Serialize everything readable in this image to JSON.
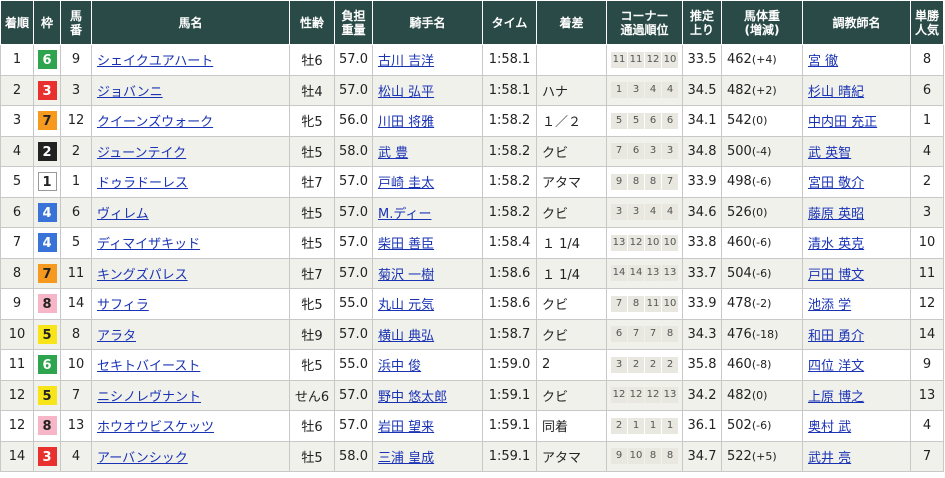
{
  "headers": {
    "rank": "着順",
    "waku": "枠",
    "umaban_1": "馬",
    "umaban_2": "番",
    "horse": "馬名",
    "sexage": "性齢",
    "weight_1": "負担",
    "weight_2": "重量",
    "jockey": "騎手名",
    "time": "タイム",
    "margin": "着差",
    "corner_1": "コーナー",
    "corner_2": "通過順位",
    "last3f_1": "推定",
    "last3f_2": "上り",
    "bodyweight_1": "馬体重",
    "bodyweight_2": "(増減)",
    "trainer": "調教師名",
    "pop_1": "単勝",
    "pop_2": "人気"
  },
  "waku_colors": {
    "1": {
      "bg": "#ffffff",
      "fg": "#222222",
      "border": "#999999"
    },
    "2": {
      "bg": "#222222",
      "fg": "#ffffff",
      "border": "#222222"
    },
    "3": {
      "bg": "#e8312f",
      "fg": "#ffffff",
      "border": "#e8312f"
    },
    "4": {
      "bg": "#3a73d8",
      "fg": "#ffffff",
      "border": "#3a73d8"
    },
    "5": {
      "bg": "#f7e51a",
      "fg": "#222222",
      "border": "#f7e51a"
    },
    "6": {
      "bg": "#2ea44f",
      "fg": "#ffffff",
      "border": "#2ea44f"
    },
    "7": {
      "bg": "#f59a1f",
      "fg": "#222222",
      "border": "#f59a1f"
    },
    "8": {
      "bg": "#f7b6c8",
      "fg": "#222222",
      "border": "#f7b6c8"
    }
  },
  "rows": [
    {
      "rank": "1",
      "waku": "6",
      "umaban": "9",
      "horse": "シェイクユアハート",
      "sexage": "牡6",
      "weight": "57.0",
      "jockey": "古川 吉洋",
      "time": "1:58.1",
      "margin": "",
      "corners": [
        "11",
        "11",
        "12",
        "10"
      ],
      "last3f": "33.5",
      "bodyweight": "462",
      "diff": "(+4)",
      "trainer": "宮 徹",
      "pop": "8"
    },
    {
      "rank": "2",
      "waku": "3",
      "umaban": "3",
      "horse": "ジョバンニ",
      "sexage": "牡4",
      "weight": "57.0",
      "jockey": "松山 弘平",
      "time": "1:58.1",
      "margin": "ハナ",
      "corners": [
        "1",
        "3",
        "4",
        "4"
      ],
      "last3f": "34.5",
      "bodyweight": "482",
      "diff": "(+2)",
      "trainer": "杉山 晴紀",
      "pop": "6"
    },
    {
      "rank": "3",
      "waku": "7",
      "umaban": "12",
      "horse": "クイーンズウォーク",
      "sexage": "牝5",
      "weight": "56.0",
      "jockey": "川田 将雅",
      "time": "1:58.2",
      "margin": "１／２",
      "corners": [
        "5",
        "5",
        "6",
        "6"
      ],
      "last3f": "34.1",
      "bodyweight": "542",
      "diff": "(0)",
      "trainer": "中内田 充正",
      "pop": "1"
    },
    {
      "rank": "4",
      "waku": "2",
      "umaban": "2",
      "horse": "ジューンテイク",
      "sexage": "牡5",
      "weight": "58.0",
      "jockey": "武 豊",
      "time": "1:58.2",
      "margin": "クビ",
      "corners": [
        "7",
        "6",
        "3",
        "3"
      ],
      "last3f": "34.8",
      "bodyweight": "500",
      "diff": "(-4)",
      "trainer": "武 英智",
      "pop": "4"
    },
    {
      "rank": "5",
      "waku": "1",
      "umaban": "1",
      "horse": "ドゥラドーレス",
      "sexage": "牡7",
      "weight": "57.0",
      "jockey": "戸崎 圭太",
      "time": "1:58.2",
      "margin": "アタマ",
      "corners": [
        "9",
        "8",
        "8",
        "7"
      ],
      "last3f": "33.9",
      "bodyweight": "498",
      "diff": "(-6)",
      "trainer": "宮田 敬介",
      "pop": "2"
    },
    {
      "rank": "6",
      "waku": "4",
      "umaban": "6",
      "horse": "ヴィレム",
      "sexage": "牡5",
      "weight": "57.0",
      "jockey": "M.ディー",
      "time": "1:58.2",
      "margin": "クビ",
      "corners": [
        "3",
        "3",
        "4",
        "4"
      ],
      "last3f": "34.6",
      "bodyweight": "526",
      "diff": "(0)",
      "trainer": "藤原 英昭",
      "pop": "3"
    },
    {
      "rank": "7",
      "waku": "4",
      "umaban": "5",
      "horse": "ディマイザキッド",
      "sexage": "牡5",
      "weight": "57.0",
      "jockey": "柴田 善臣",
      "time": "1:58.4",
      "margin": "１ 1/4",
      "corners": [
        "13",
        "12",
        "10",
        "10"
      ],
      "last3f": "33.8",
      "bodyweight": "460",
      "diff": "(-6)",
      "trainer": "清水 英克",
      "pop": "10"
    },
    {
      "rank": "8",
      "waku": "7",
      "umaban": "11",
      "horse": "キングズパレス",
      "sexage": "牡7",
      "weight": "57.0",
      "jockey": "菊沢 一樹",
      "time": "1:58.6",
      "margin": "１ 1/4",
      "corners": [
        "14",
        "14",
        "13",
        "13"
      ],
      "last3f": "33.7",
      "bodyweight": "504",
      "diff": "(-6)",
      "trainer": "戸田 博文",
      "pop": "11"
    },
    {
      "rank": "9",
      "waku": "8",
      "umaban": "14",
      "horse": "サフィラ",
      "sexage": "牝5",
      "weight": "55.0",
      "jockey": "丸山 元気",
      "time": "1:58.6",
      "margin": "クビ",
      "corners": [
        "7",
        "8",
        "11",
        "10"
      ],
      "last3f": "33.9",
      "bodyweight": "478",
      "diff": "(-2)",
      "trainer": "池添 学",
      "pop": "12"
    },
    {
      "rank": "10",
      "waku": "5",
      "umaban": "8",
      "horse": "アラタ",
      "sexage": "牡9",
      "weight": "57.0",
      "jockey": "横山 典弘",
      "time": "1:58.7",
      "margin": "クビ",
      "corners": [
        "6",
        "7",
        "7",
        "8"
      ],
      "last3f": "34.3",
      "bodyweight": "476",
      "diff": "(-18)",
      "trainer": "和田 勇介",
      "pop": "14"
    },
    {
      "rank": "11",
      "waku": "6",
      "umaban": "10",
      "horse": "セキトバイースト",
      "sexage": "牝5",
      "weight": "55.0",
      "jockey": "浜中 俊",
      "time": "1:59.0",
      "margin": "2",
      "corners": [
        "3",
        "2",
        "2",
        "2"
      ],
      "last3f": "35.8",
      "bodyweight": "460",
      "diff": "(-8)",
      "trainer": "四位 洋文",
      "pop": "9"
    },
    {
      "rank": "12",
      "waku": "5",
      "umaban": "7",
      "horse": "ニシノレヴナント",
      "sexage": "せん6",
      "weight": "57.0",
      "jockey": "野中 悠太郎",
      "time": "1:59.1",
      "margin": "クビ",
      "corners": [
        "12",
        "12",
        "12",
        "13"
      ],
      "last3f": "34.2",
      "bodyweight": "482",
      "diff": "(0)",
      "trainer": "上原 博之",
      "pop": "13"
    },
    {
      "rank": "12",
      "waku": "8",
      "umaban": "13",
      "horse": "ホウオウビスケッツ",
      "sexage": "牡6",
      "weight": "57.0",
      "jockey": "岩田 望来",
      "time": "1:59.1",
      "margin": "同着",
      "corners": [
        "2",
        "1",
        "1",
        "1"
      ],
      "last3f": "36.1",
      "bodyweight": "502",
      "diff": "(-6)",
      "trainer": "奥村 武",
      "pop": "4"
    },
    {
      "rank": "14",
      "waku": "3",
      "umaban": "4",
      "horse": "アーバンシック",
      "sexage": "牡5",
      "weight": "58.0",
      "jockey": "三浦 皇成",
      "time": "1:59.1",
      "margin": "アタマ",
      "corners": [
        "9",
        "10",
        "8",
        "8"
      ],
      "last3f": "34.7",
      "bodyweight": "522",
      "diff": "(+5)",
      "trainer": "武井 亮",
      "pop": "7"
    }
  ]
}
